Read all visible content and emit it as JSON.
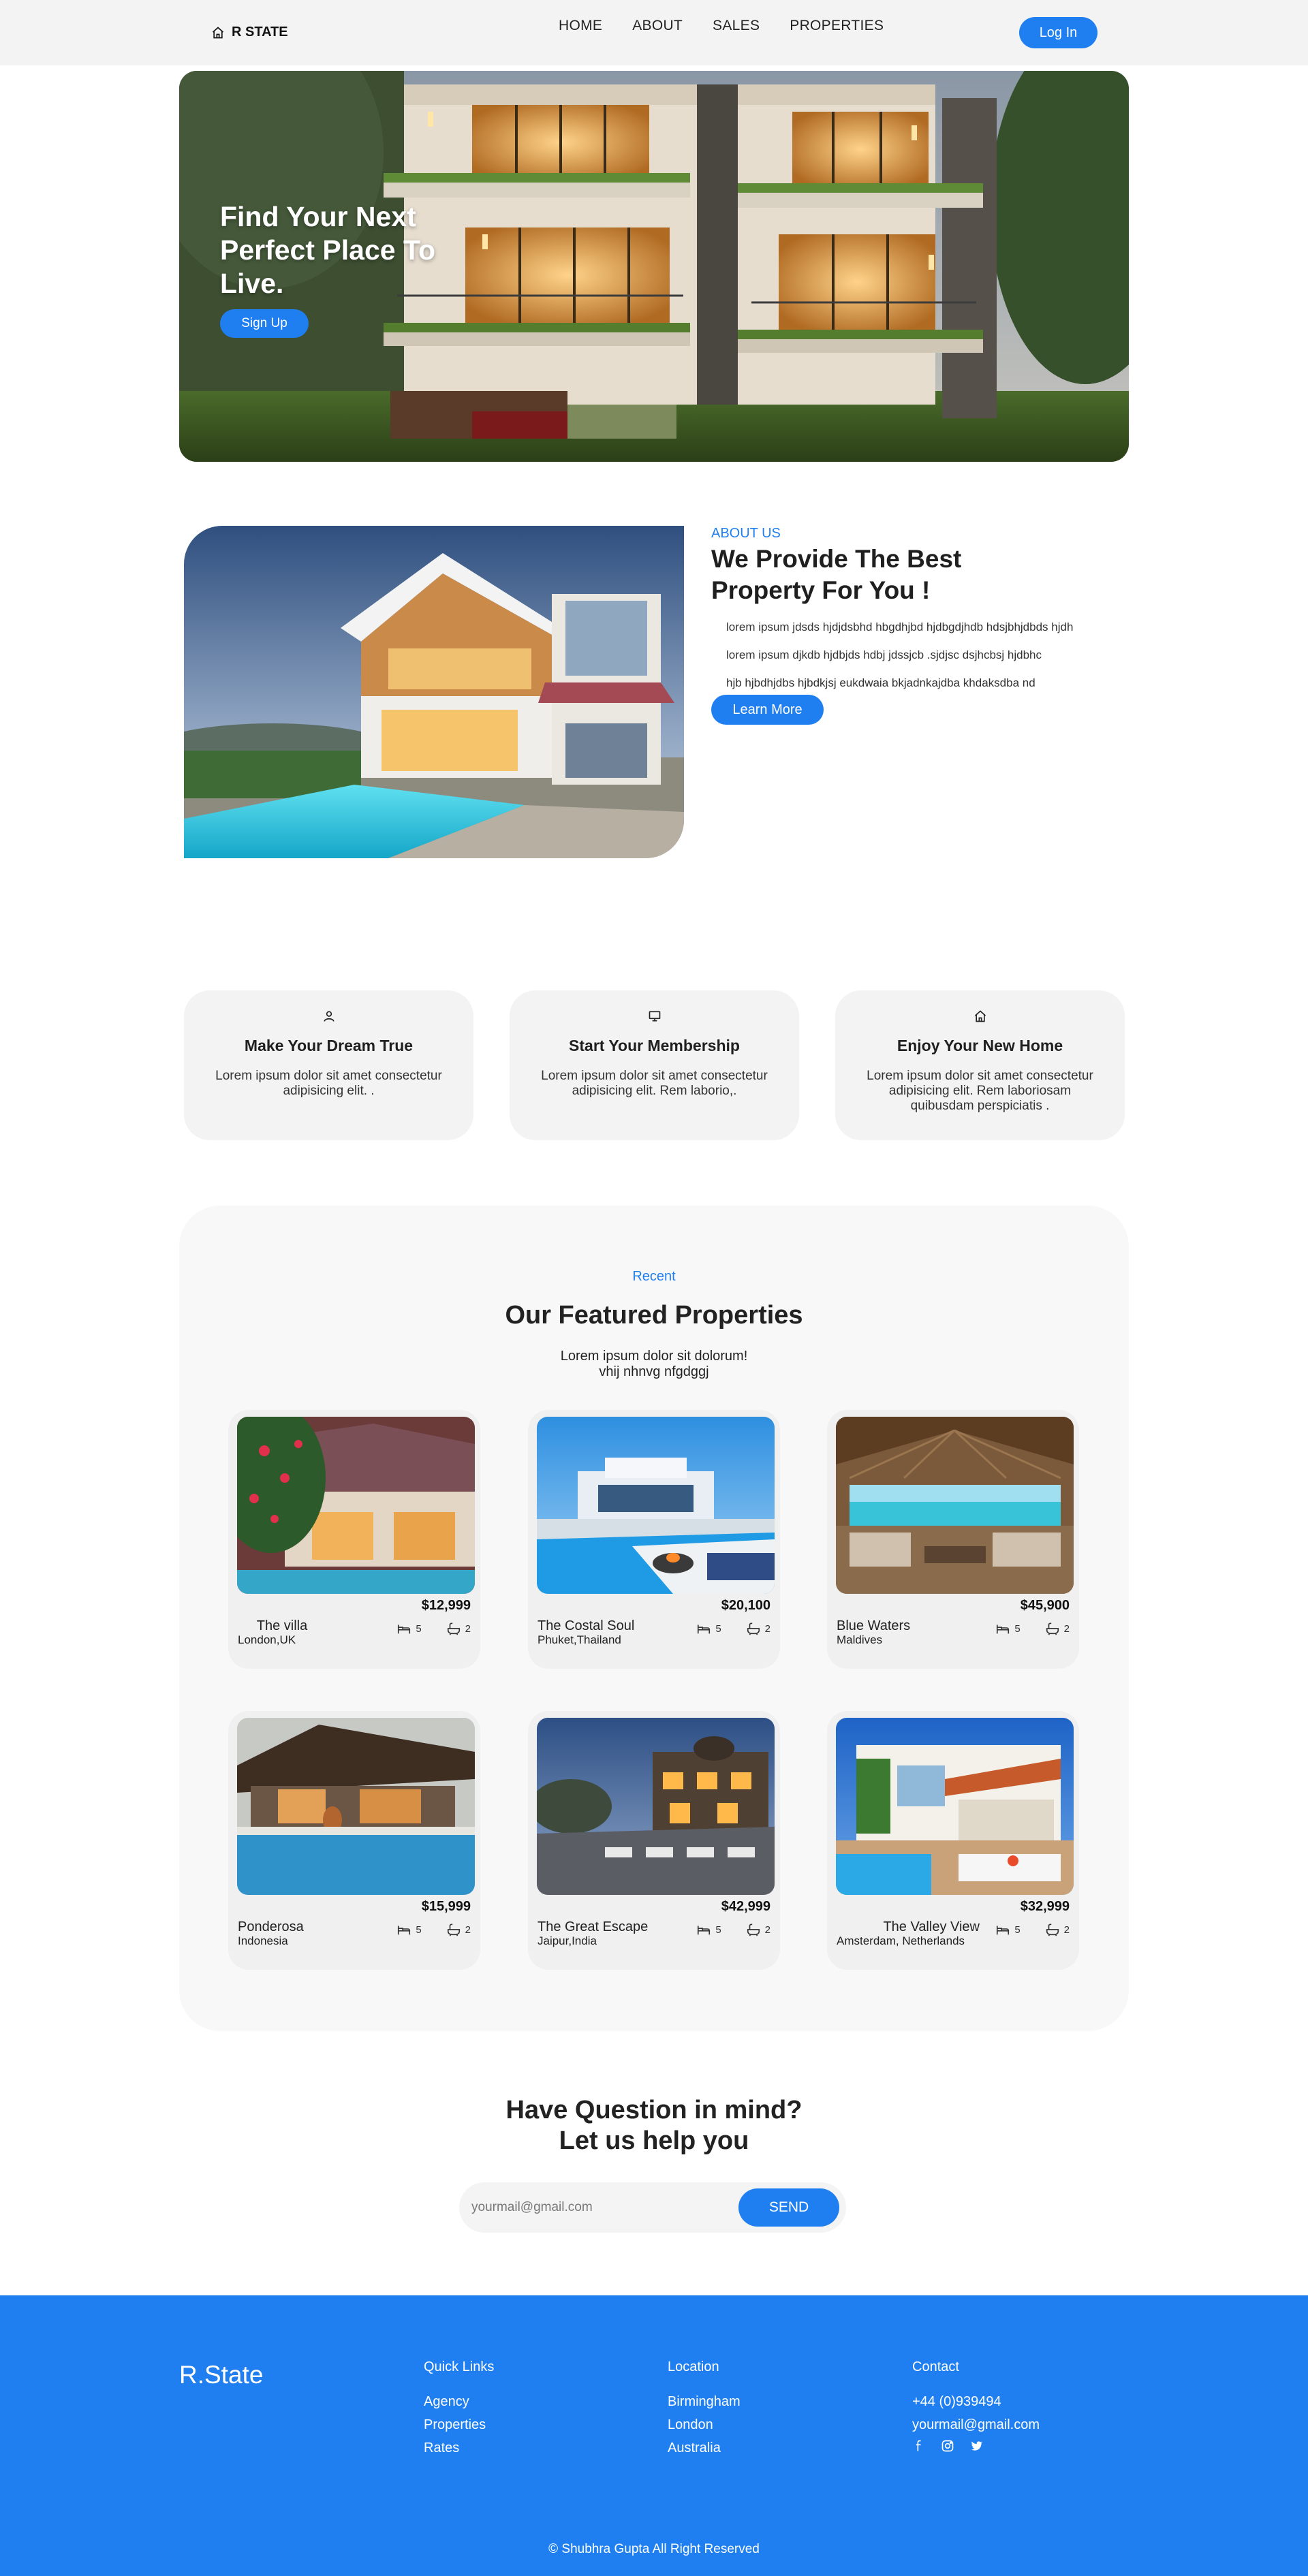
{
  "nav": {
    "brand": "R STATE",
    "links": [
      "HOME",
      "ABOUT",
      "SALES",
      "PROPERTIES"
    ],
    "login": "Log In"
  },
  "hero": {
    "title": "Find Your Next Perfect Place To Live.",
    "signup": "Sign Up"
  },
  "about": {
    "kicker": "ABOUT US",
    "title": "We Provide The Best Property For You !",
    "lines": [
      "lorem ipsum jdsds hjdjdsbhd hbgdhjbd hjdbgdjhdb hdsjbhjdbds hjdh",
      "lorem ipsum djkdb hjdbjds hdbj jdssjcb .sjdjsc dsjhcbsj hjdbhc",
      "hjb hjbdhjdbs hjbdkjsj eukdwaia bkjadnkajdba khdaksdba nd"
    ],
    "button": "Learn More"
  },
  "features": [
    {
      "icon": "user-icon",
      "title": "Make Your Dream True",
      "text": "Lorem ipsum dolor sit amet consectetur adipisicing elit. ."
    },
    {
      "icon": "monitor-icon",
      "title": "Start Your Membership",
      "text": "Lorem ipsum dolor sit amet consectetur adipisicing elit. Rem laborio,."
    },
    {
      "icon": "home-icon",
      "title": "Enjoy Your New Home",
      "text": "Lorem ipsum dolor sit amet consectetur adipisicing elit. Rem laboriosam quibusdam perspiciatis ."
    }
  ],
  "featured": {
    "kicker": "Recent",
    "title": "Our Featured Properties",
    "subtitle_line1": "Lorem ipsum dolor sit dolorum!",
    "subtitle_line2": "vhij nhnvg nfgdggj",
    "properties": [
      {
        "name": "The villa",
        "location": "London,UK",
        "price": "$12,999",
        "beds": "5",
        "baths": "2"
      },
      {
        "name": "The Costal Soul",
        "location": "Phuket,Thailand",
        "price": "$20,100",
        "beds": "5",
        "baths": "2"
      },
      {
        "name": "Blue Waters",
        "location": "Maldives",
        "price": "$45,900",
        "beds": "5",
        "baths": "2"
      },
      {
        "name": "Ponderosa",
        "location": "Indonesia",
        "price": "$15,999",
        "beds": "5",
        "baths": "2"
      },
      {
        "name": "The Great Escape",
        "location": "Jaipur,India",
        "price": "$42,999",
        "beds": "5",
        "baths": "2"
      },
      {
        "name": "The Valley View",
        "location": "Amsterdam, Netherlands",
        "price": "$32,999",
        "beds": "5",
        "baths": "2"
      }
    ]
  },
  "contact": {
    "title_line1": "Have Question in mind?",
    "title_line2": "Let us help you",
    "placeholder": "yourmail@gmail.com",
    "send": "SEND"
  },
  "footer": {
    "brand": "R.State",
    "quick_links": {
      "heading": "Quick Links",
      "items": [
        "Agency",
        "Properties",
        "Rates"
      ]
    },
    "location": {
      "heading": "Location",
      "items": [
        "Birmingham",
        "London",
        "Australia"
      ]
    },
    "contact": {
      "heading": "Contact",
      "phone": "+44 (0)939494",
      "email": "yourmail@gmail.com"
    },
    "socials": [
      "facebook-icon",
      "instagram-icon",
      "twitter-icon"
    ],
    "copyright": "© Shubhra Gupta All Right Reserved"
  },
  "colors": {
    "accent": "#1f7ff0",
    "card_bg": "#f3f3f3",
    "section_bg": "#f8f8f8"
  }
}
